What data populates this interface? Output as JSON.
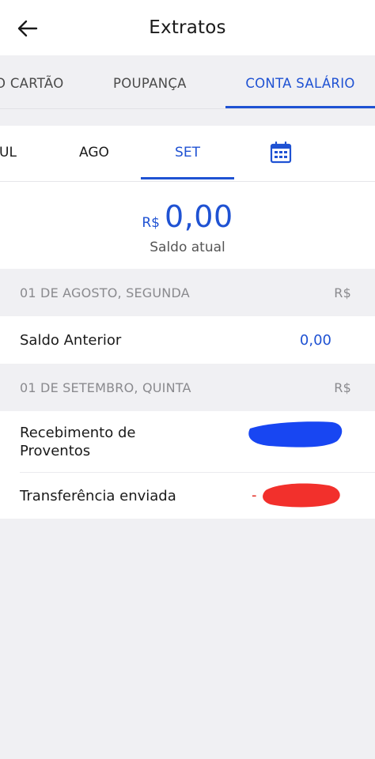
{
  "header": {
    "title": "Extratos",
    "back_icon": "arrow-left-icon"
  },
  "account_tabs": [
    {
      "label": "O CARTÃO",
      "selected": false
    },
    {
      "label": "POUPANÇA",
      "selected": false
    },
    {
      "label": "CONTA SALÁRIO",
      "selected": true
    }
  ],
  "months": [
    {
      "label": "UL",
      "selected": false
    },
    {
      "label": "AGO",
      "selected": false
    },
    {
      "label": "SET",
      "selected": true
    }
  ],
  "calendar_icon": "calendar-icon",
  "balance": {
    "currency": "R$",
    "amount": "0,00",
    "label": "Saldo atual"
  },
  "days": [
    {
      "header": "01 DE AGOSTO, SEGUNDA",
      "currency": "R$",
      "entries": [
        {
          "label": "Saldo Anterior",
          "value": "0,00"
        }
      ]
    },
    {
      "header": "01 DE SETEMBRO, QUINTA",
      "currency": "R$",
      "entries": [
        {
          "label": "Recebimento de Proventos",
          "value": ""
        },
        {
          "label": "Transferência enviada",
          "sign": "-",
          "value": ""
        }
      ]
    }
  ],
  "colors": {
    "accent": "#1f52d3",
    "credit_redaction": "#1846f2",
    "debit_redaction": "#f2302c"
  }
}
